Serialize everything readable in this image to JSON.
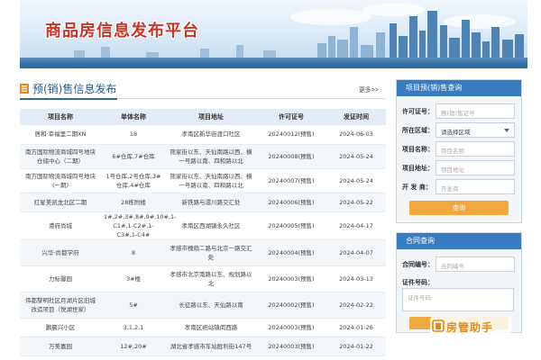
{
  "banner": {
    "title": "商品房信息发布平台"
  },
  "listing": {
    "title": "预(销)售信息发布",
    "more": "更多>>",
    "columns": [
      "项目名称",
      "单体名称",
      "项目地址",
      "许可证号",
      "发证时间"
    ],
    "rows": [
      [
        "居和·幸福里二期XN",
        "18",
        "孝南区新华街渡口社区",
        "20240012(预售)",
        "2024-06-03"
      ],
      [
        "南方国际物流商城四号地块仓储中心（二期）",
        "6#仓库,7#仓库",
        "熊家街以东、天仙南路以西、横一号路以南、四和路以北",
        "20240008(预售)",
        "2024-05-24"
      ],
      [
        "南方国际物流商城四号地块(一期)",
        "1号仓库,2号仓库,3#仓库,4#仓库",
        "熊家街以东、天仙南路以西、横一号路以南、四和路以北",
        "20240007(预售)",
        "2024-05-24"
      ],
      [
        "红星美凯龙北区二期",
        "28栋附楼",
        "新铁路与澴川路交汇处",
        "20240006(预售)",
        "2024-05-22"
      ],
      [
        "港府尚城",
        "1#,2#,3#,8#,9#,10#,1-C1#,1-C2#,1-C3#,1-C4#",
        "孝南区西湖镇永久社区",
        "20240005(预售)",
        "2024-04-17"
      ],
      [
        "兴华·尚都学府",
        "8",
        "孝感市槐荫二路与北京一路交汇处",
        "20240004(预售)",
        "2024-04-07"
      ],
      [
        "力标馨园",
        "3#楼",
        "孝感市北京南路以东、规划路以北",
        "20240003(预售)",
        "2024-03-13"
      ],
      [
        "伟都黎明社区月湖片区旧城改造项目（悦湖世家）",
        "5#",
        "长征路以东、天仙路以南",
        "20240002(预售)",
        "2024-02-22"
      ],
      [
        "鹏晨兴小区",
        "3,1,2,1",
        "孝南区祝站镇闵西路",
        "20240003(预售)",
        "2024-01-26"
      ],
      [
        "万美嘉园",
        "12#,20#",
        "湖北省孝感市车站胜利街147号",
        "20240003(预售)",
        "2024-01-22"
      ]
    ]
  },
  "query_panel": {
    "title": "项目预(销)售查询",
    "fields": [
      {
        "label": "许可证号：",
        "placeholder": "预(销)售证号"
      },
      {
        "label": "所在区域：",
        "value": "请选择区域"
      },
      {
        "label": "项目名称：",
        "placeholder": "项目名称"
      },
      {
        "label": "项目地址：",
        "placeholder": "项目地址"
      },
      {
        "label": "开 发 商：",
        "placeholder": "开发商"
      }
    ],
    "button": "查询"
  },
  "contract_panel": {
    "title": "合同查询",
    "contract_label": "合同编号：",
    "contract_placeholder": "合同编号",
    "cert_label": "证件号码：",
    "cert_placeholder": "证件号码"
  },
  "watermark": {
    "text": "房管助手"
  },
  "colors": {
    "accent": "#2f6aa0",
    "panel_header": "#3a7cc0",
    "button": "#f0a841",
    "banner_title": "#c0392b"
  }
}
